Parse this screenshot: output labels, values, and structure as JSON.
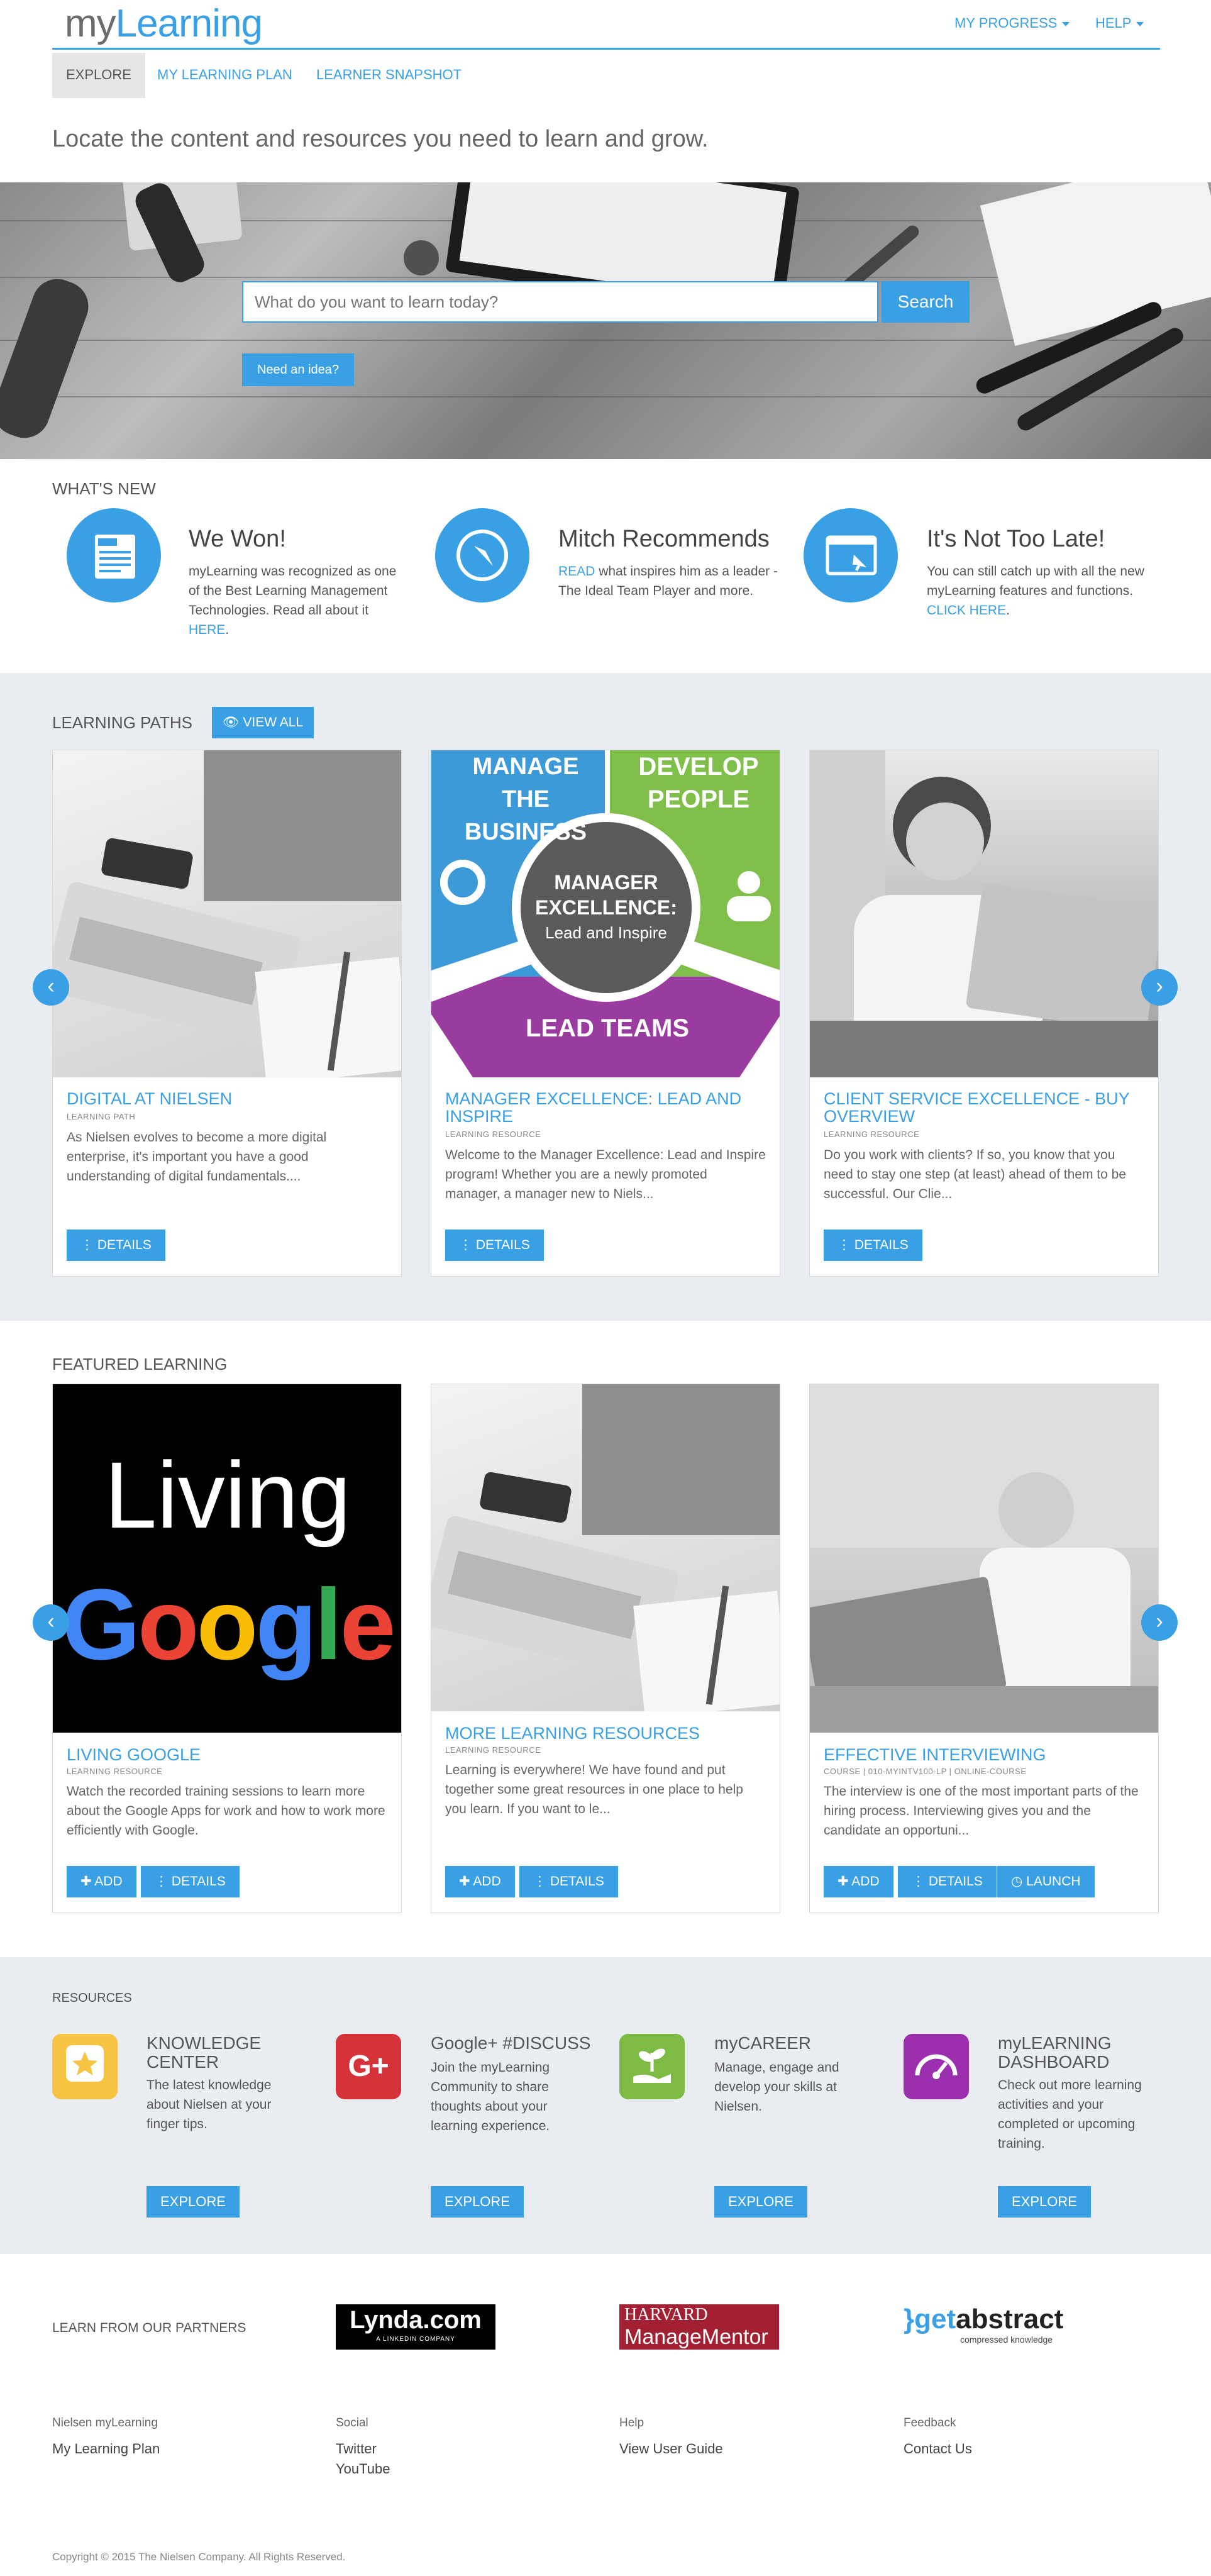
{
  "brand": {
    "logo_my": "my",
    "logo_learning": "Learning"
  },
  "top_nav": {
    "my_progress": "MY PROGRESS",
    "help": "HELP"
  },
  "tabs": [
    {
      "label": "EXPLORE"
    },
    {
      "label": "MY LEARNING PLAN"
    },
    {
      "label": "LEARNER SNAPSHOT"
    }
  ],
  "tagline": "Locate the content and resources you need to learn and grow.",
  "search": {
    "placeholder": "What do you want to learn today?",
    "button": "Search",
    "idea_button": "Need an idea?"
  },
  "whats_new": {
    "title": "WHAT'S NEW",
    "items": [
      {
        "title": "We Won!",
        "body": "myLearning was recognized as one of the Best Learning Management Technologies. Read all about it",
        "link": "HERE",
        "after": "."
      },
      {
        "title": "Mitch Recommends",
        "link": "READ",
        "body": "what inspires him as a leader - The Ideal Team Player and more."
      },
      {
        "title": "It's Not Too Late!",
        "body": "You can still catch up with all the new myLearning features and functions.",
        "link": "CLICK HERE",
        "after": "."
      }
    ]
  },
  "learning_paths": {
    "title": "LEARNING PATHS",
    "view_all": "VIEW ALL",
    "cards": [
      {
        "title": "DIGITAL AT NIELSEN",
        "type": "LEARNING PATH",
        "desc": "As Nielsen evolves to become a more digital enterprise, it's important you have a good understanding of digital fundamentals....",
        "details": "DETAILS"
      },
      {
        "title": "MANAGER EXCELLENCE: LEAD AND INSPIRE",
        "type": "LEARNING RESOURCE",
        "desc": "Welcome to the Manager Excellence: Lead and Inspire program! Whether you are a newly promoted manager, a manager new to Niels...",
        "details": "DETAILS",
        "art": {
          "q1": "MANAGE",
          "q1b": "THE BUSINESS",
          "q2": "DEVELOP",
          "q2b": "PEOPLE",
          "center1": "MANAGER",
          "center2": "EXCELLENCE:",
          "center3": "Lead and Inspire",
          "bottom": "LEAD TEAMS"
        }
      },
      {
        "title": "CLIENT SERVICE EXCELLENCE - BUY OVERVIEW",
        "type": "LEARNING RESOURCE",
        "desc": "Do you work with clients? If so, you know that you need to stay one step (at least) ahead of them to be successful. Our Clie...",
        "details": "DETAILS"
      }
    ]
  },
  "featured": {
    "title": "FEATURED LEARNING",
    "cards": [
      {
        "title": "LIVING GOOGLE",
        "type": "LEARNING RESOURCE",
        "desc": "Watch the recorded training sessions to learn more about the Google Apps for work and how to work more efficiently with Google.",
        "add": "ADD",
        "details": "DETAILS",
        "art_text": "Living",
        "google": [
          "G",
          "o",
          "o",
          "g",
          "l",
          "e"
        ]
      },
      {
        "title": "MORE LEARNING RESOURCES",
        "type": "LEARNING RESOURCE",
        "desc": "Learning is everywhere! We have found and put together some great resources in one place to help you learn. If you want to le...",
        "add": "ADD",
        "details": "DETAILS"
      },
      {
        "title": "EFFECTIVE INTERVIEWING",
        "type": "COURSE",
        "type2": "010-MYINTV100-LP",
        "type3": "ONLINE-COURSE",
        "desc": "The interview is one of the most important parts of the hiring process. Interviewing gives you and the candidate an opportuni...",
        "add": "ADD",
        "details": "DETAILS",
        "launch": "LAUNCH"
      }
    ]
  },
  "resources": {
    "title": "RESOURCES",
    "items": [
      {
        "title": "KNOWLEDGE CENTER",
        "body": "The latest knowledge about Nielsen at your finger tips.",
        "button": "EXPLORE",
        "color": "#f6c342"
      },
      {
        "title": "Google+ #DISCUSS",
        "body": "Join the myLearning Community to share thoughts about your learning experience.",
        "button": "EXPLORE",
        "color": "#d6323a",
        "icon_text": "G+"
      },
      {
        "title": "myCAREER",
        "body": "Manage, engage and develop your skills at Nielsen.",
        "button": "EXPLORE",
        "color": "#7dbb45"
      },
      {
        "title": "myLEARNING DASHBOARD",
        "body": "Check out more learning activities and your completed or upcoming training.",
        "button": "EXPLORE",
        "color": "#9b2fae"
      }
    ]
  },
  "partners": {
    "label": "LEARN FROM OUR PARTNERS",
    "lynda": "Lynda.com",
    "lynda_sub": "A LINKEDIN COMPANY",
    "harvard1": "HARVARD",
    "harvard2": "ManageMentor",
    "getabstract1": "get",
    "getabstract2": "abstract",
    "getabstract_sub": "compressed knowledge"
  },
  "footer": {
    "cols": [
      {
        "head": "Nielsen myLearning",
        "links": [
          "My Learning Plan"
        ]
      },
      {
        "head": "Social",
        "links": [
          "Twitter",
          "YouTube"
        ]
      },
      {
        "head": "Help",
        "links": [
          "View User Guide"
        ]
      },
      {
        "head": "Feedback",
        "links": [
          "Contact Us"
        ]
      }
    ],
    "copyright": "Copyright © 2015 The Nielsen Company. All Rights Reserved."
  }
}
